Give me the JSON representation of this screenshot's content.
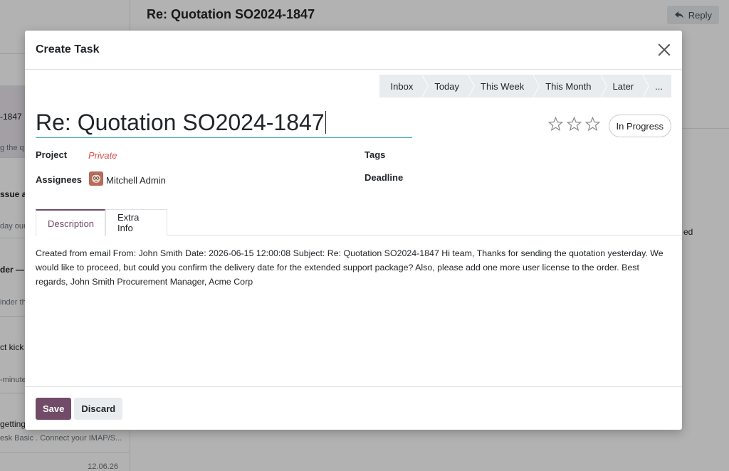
{
  "background": {
    "header_title": "Re: Quotation SO2024-1847",
    "reply_label": "Reply",
    "side_fragment": "ed",
    "list": [
      {
        "title": "-1847",
        "preview": "g the q",
        "active": true
      },
      {
        "title": "ssue af",
        "preview": "day our"
      },
      {
        "title": "der —",
        "preview": "inder th"
      },
      {
        "title": "ct kick",
        "preview": "-minute"
      },
      {
        "title": "getting",
        "preview": "esk Basic . Connect your IMAP/S..."
      }
    ],
    "last_date": "12.06.26"
  },
  "modal": {
    "title": "Create Task",
    "stages": [
      "Inbox",
      "Today",
      "This Week",
      "This Month",
      "Later",
      "..."
    ],
    "task_name": "Re: Quotation SO2024-1847",
    "state": "In Progress",
    "priority_stars": 3,
    "fields": {
      "project_label": "Project",
      "project_value": "Private",
      "assignees_label": "Assignees",
      "assignee_name": "Mitchell Admin",
      "tags_label": "Tags",
      "deadline_label": "Deadline"
    },
    "tabs": [
      "Description",
      "Extra Info"
    ],
    "description": "Created from email From: John Smith Date: 2026-06-15 12:00:08 Subject: Re: Quotation SO2024-1847 Hi team, Thanks for sending the quotation yesterday. We would like to proceed, but could you confirm the delivery date for the extended support package? Also, please add one more user license to the order. Best regards, John Smith Procurement Manager, Acme Corp",
    "save_label": "Save",
    "discard_label": "Discard"
  }
}
